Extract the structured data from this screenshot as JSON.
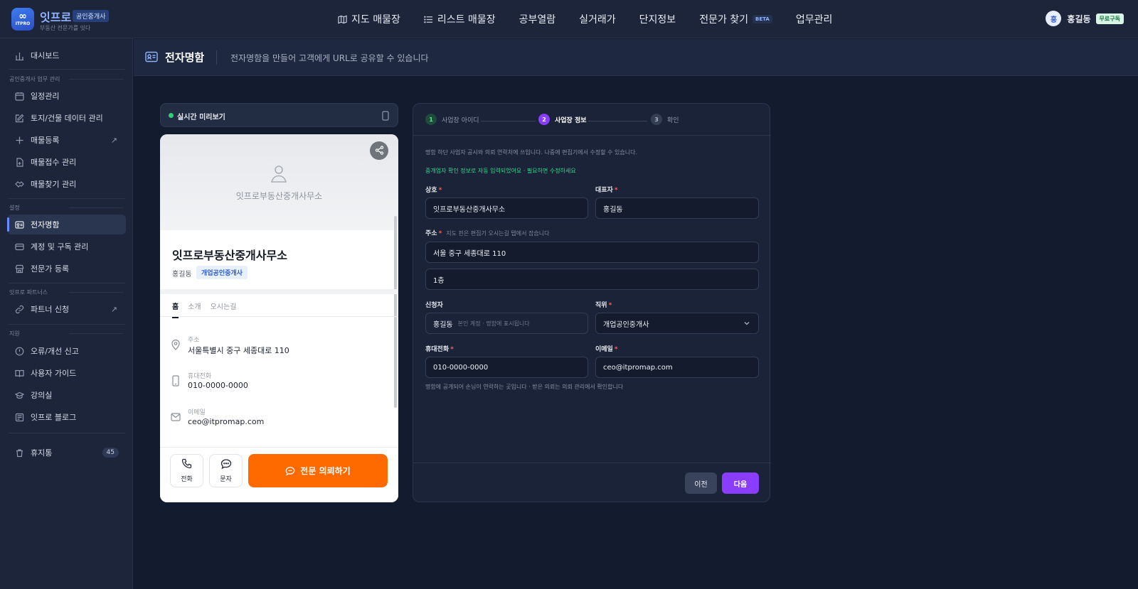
{
  "app": {
    "brand": "잇프로",
    "logo_mini": "ITPRO",
    "brand_badge": "공인중개사",
    "tagline": "부동산 전문가를 잇다"
  },
  "nav": [
    {
      "label": "지도 매물장",
      "icon": "map-icon"
    },
    {
      "label": "리스트 매물장",
      "icon": "list-icon"
    },
    {
      "label": "공부열람",
      "icon": ""
    },
    {
      "label": "실거래가",
      "icon": ""
    },
    {
      "label": "단지정보",
      "icon": ""
    },
    {
      "label": "전문가 찾기",
      "icon": "",
      "badge": "BETA"
    },
    {
      "label": "업무관리",
      "icon": ""
    }
  ],
  "user": {
    "initial": "홍",
    "name": "홍길동",
    "plan": "무료구독"
  },
  "sidebar": {
    "dashboard": "대시보드",
    "section_work": "공인중개사 업무 관리",
    "items_work": [
      "일정관리",
      "토지/건물 데이터 관리",
      "매물등록",
      "매물접수 관리",
      "매물찾기 관리"
    ],
    "section_settings": "설정",
    "items_settings": [
      "전자명함",
      "계정 및 구독 관리",
      "전문가 등록"
    ],
    "section_partners": "잇프로 파트너스",
    "items_partners": [
      "파트너 신청"
    ],
    "section_support": "지원",
    "items_support": [
      "오류/개선 신고",
      "사용자 가이드",
      "강의실",
      "잇프로 블로그"
    ],
    "trash": "휴지통",
    "trash_count": "45"
  },
  "page": {
    "title": "전자명함",
    "description": "전자명함을 만들어 고객에게 URL로 공유할 수 있습니다"
  },
  "preview": {
    "label": "실시간 미리보기",
    "hero_name": "잇프로부동산중개사무소",
    "office": "잇프로부동산중개사무소",
    "person": "홍길동",
    "role": "개업공인중개사",
    "tabs": [
      "홈",
      "소개",
      "오시는길"
    ],
    "address_label": "주소",
    "address": "서울특별시 중구 세종대로 110",
    "phone_label": "휴대전화",
    "phone": "010-0000-0000",
    "email_label": "이메일",
    "email": "ceo@itpromap.com",
    "call": "전화",
    "sms": "문자",
    "cta": "전문 의뢰하기"
  },
  "steps": [
    {
      "num": "1",
      "label": "사업장 아이디",
      "state": "done"
    },
    {
      "num": "2",
      "label": "사업장 정보",
      "state": "current"
    },
    {
      "num": "3",
      "label": "확인",
      "state": "todo"
    }
  ],
  "form": {
    "note": "명함 하단 사업자 공시와 의뢰 연락처에 쓰입니다. 나중에 편집기에서 수정할 수 있습니다.",
    "auto_note": "중개업자 확인 정보로 자동 입력되었어요 · 필요하면 수정하세요",
    "company_label": "상호",
    "company_value": "잇프로부동산중개사무소",
    "ceo_label": "대표자",
    "ceo_value": "홍길동",
    "address_label": "주소",
    "address_hint": "지도 핀은 편집기 오시는길 탭에서 잡습니다",
    "address_value": "서울 중구 세종대로 110",
    "address_detail": "1층",
    "applicant_label": "신청자",
    "applicant_value": "홍길동",
    "applicant_sub": "본인 계정 · 명함에 표시됩니다",
    "position_label": "직위",
    "position_value": "개업공인중개사",
    "mobile_label": "휴대전화",
    "mobile_value": "010-0000-0000",
    "email_label": "이메일",
    "email_value": "ceo@itpromap.com",
    "contact_note": "명함에 공개되어 손님이 연락하는 곳입니다 · 받은 의뢰는 의뢰 관리에서 확인합니다",
    "prev": "이전",
    "next": "다음",
    "required_mark": "*"
  }
}
